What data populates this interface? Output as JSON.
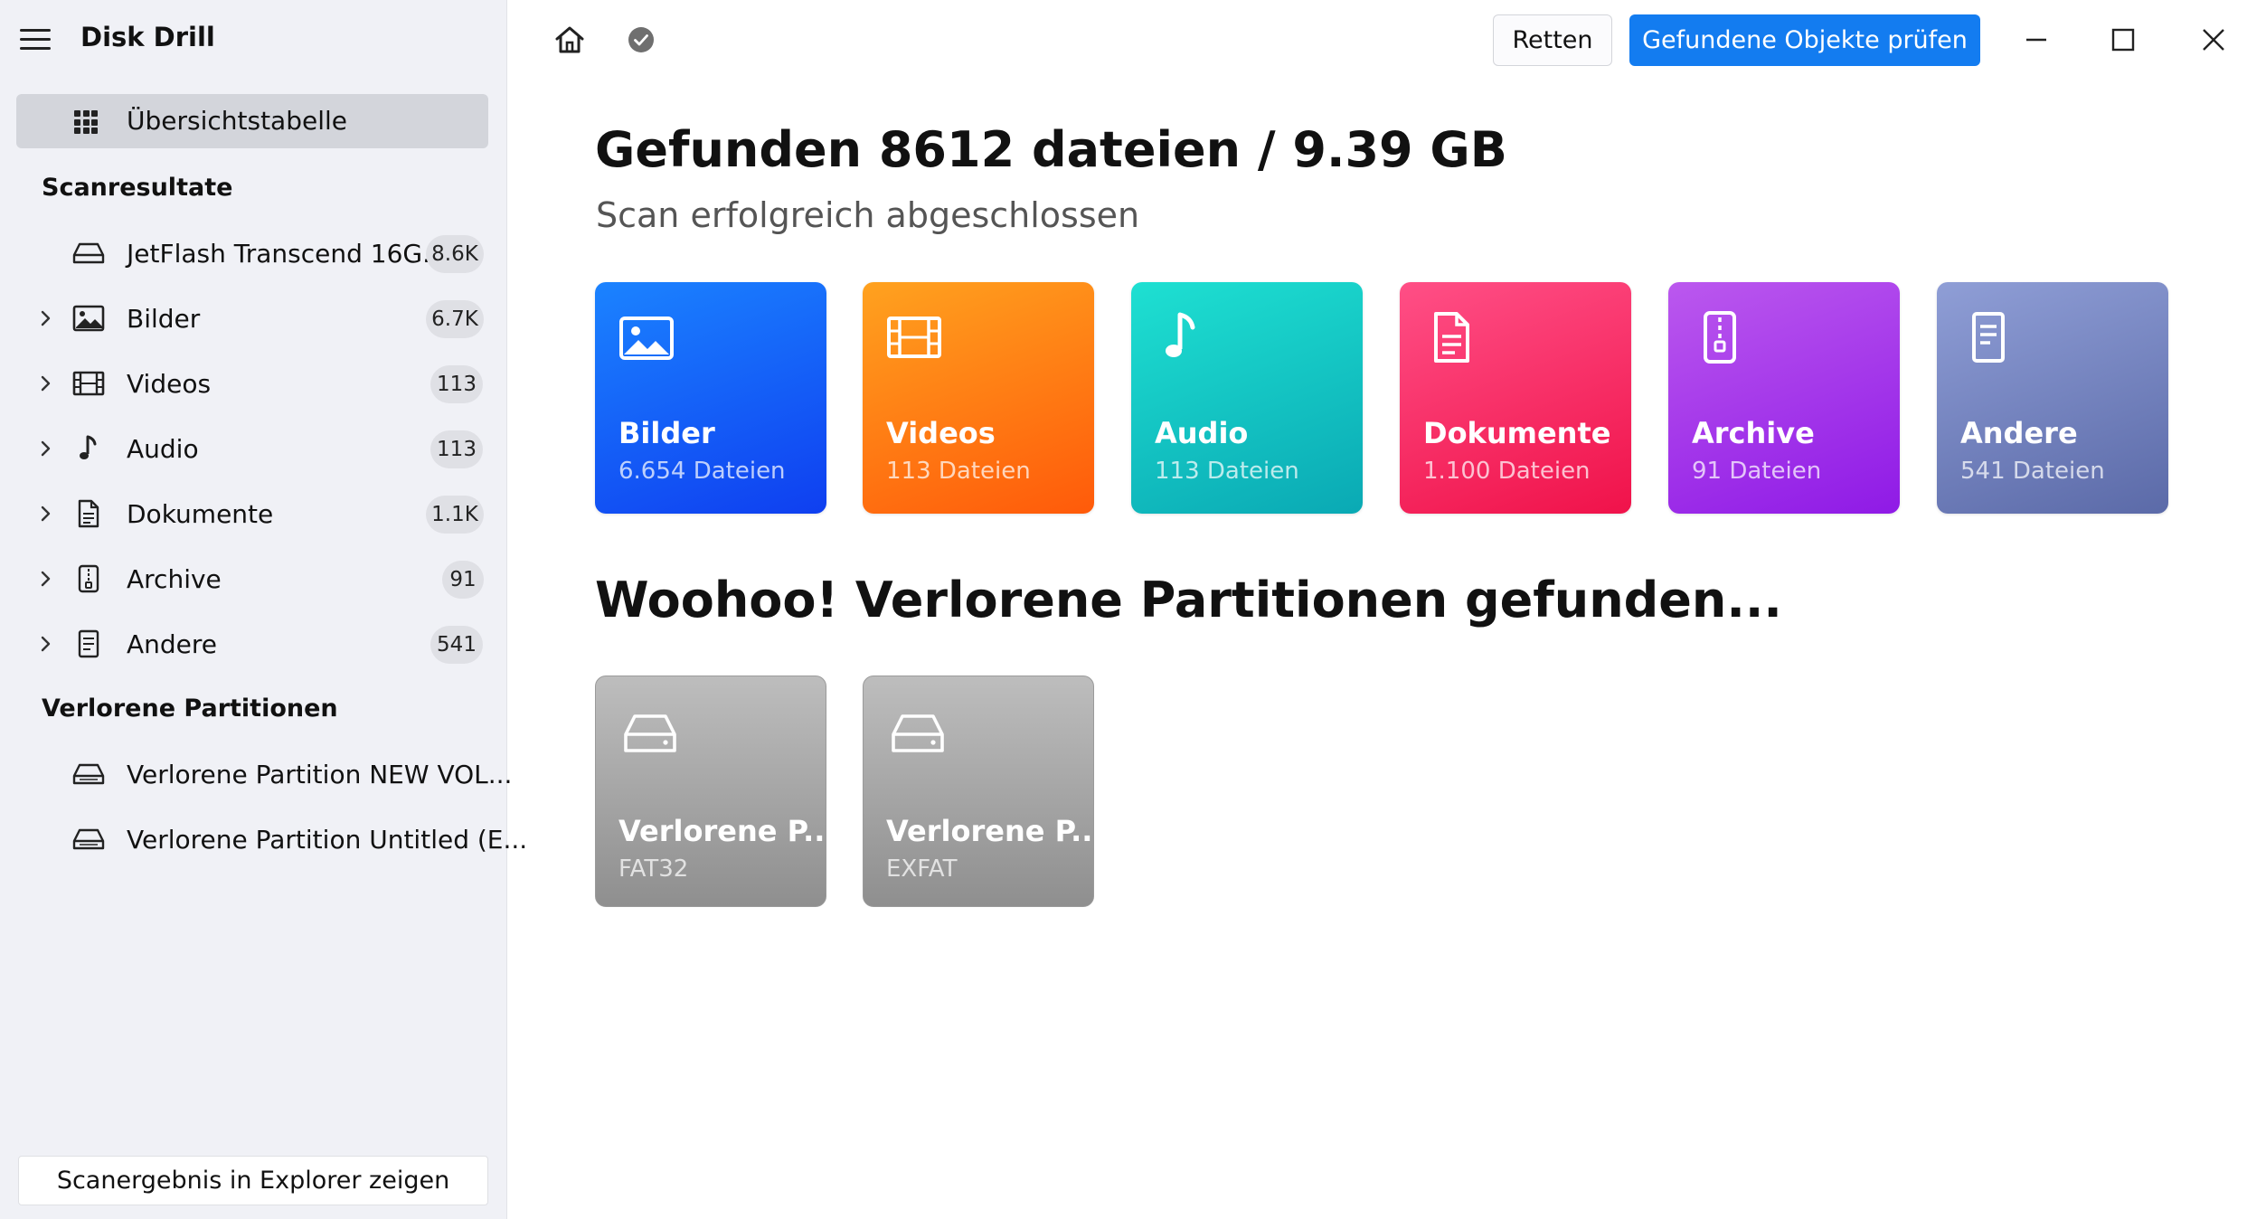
{
  "app": {
    "title": "Disk Drill"
  },
  "sidebar": {
    "selected_item": {
      "label": "Übersichtstabelle",
      "icon": "grid-icon"
    },
    "scan_results_title": "Scanresultate",
    "device": {
      "label": "JetFlash Transcend 16G...",
      "count": "8.6K",
      "icon": "drive-icon"
    },
    "categories": [
      {
        "label": "Bilder",
        "count": "6.7K",
        "icon": "image-icon"
      },
      {
        "label": "Videos",
        "count": "113",
        "icon": "film-icon"
      },
      {
        "label": "Audio",
        "count": "113",
        "icon": "music-note-icon"
      },
      {
        "label": "Dokumente",
        "count": "1.1K",
        "icon": "document-icon"
      },
      {
        "label": "Archive",
        "count": "91",
        "icon": "archive-zip-icon"
      },
      {
        "label": "Andere",
        "count": "541",
        "icon": "other-file-icon"
      }
    ],
    "lost_partitions_title": "Verlorene Partitionen",
    "lost_partitions": [
      {
        "label": "Verlorene Partition NEW VOL...",
        "icon": "drive-icon"
      },
      {
        "label": "Verlorene Partition Untitled (E...",
        "icon": "drive-icon"
      }
    ],
    "explorer_button": "Scanergebnis in Explorer zeigen"
  },
  "toolbar": {
    "retten_label": "Retten",
    "primary_label": "Gefundene Objekte prüfen"
  },
  "main": {
    "heading": "Gefunden 8612 dateien / 9.39 GB",
    "subheading": "Scan erfolgreich abgeschlossen",
    "cards": [
      {
        "title": "Bilder",
        "subtitle": "6.654 Dateien",
        "colors": [
          "#1b83ff",
          "#0f3ff0"
        ]
      },
      {
        "title": "Videos",
        "subtitle": "113 Dateien",
        "colors": [
          "#ffa21f",
          "#ff5a0a"
        ]
      },
      {
        "title": "Audio",
        "subtitle": "113 Dateien",
        "colors": [
          "#1ee0d2",
          "#0aa9b4"
        ]
      },
      {
        "title": "Dokumente",
        "subtitle": "1.100 Dateien",
        "colors": [
          "#ff4f86",
          "#f0124a"
        ]
      },
      {
        "title": "Archive",
        "subtitle": "91 Dateien",
        "colors": [
          "#bb58ee",
          "#8f1ae6"
        ]
      },
      {
        "title": "Andere",
        "subtitle": "541 Dateien",
        "colors": [
          "#8f9ed6",
          "#5b6aa8"
        ]
      }
    ],
    "partitions_heading": "Woohoo! Verlorene Partitionen gefunden...",
    "partitions": [
      {
        "title": "Verlorene P...",
        "subtitle": "FAT32"
      },
      {
        "title": "Verlorene P...",
        "subtitle": "EXFAT"
      }
    ]
  }
}
